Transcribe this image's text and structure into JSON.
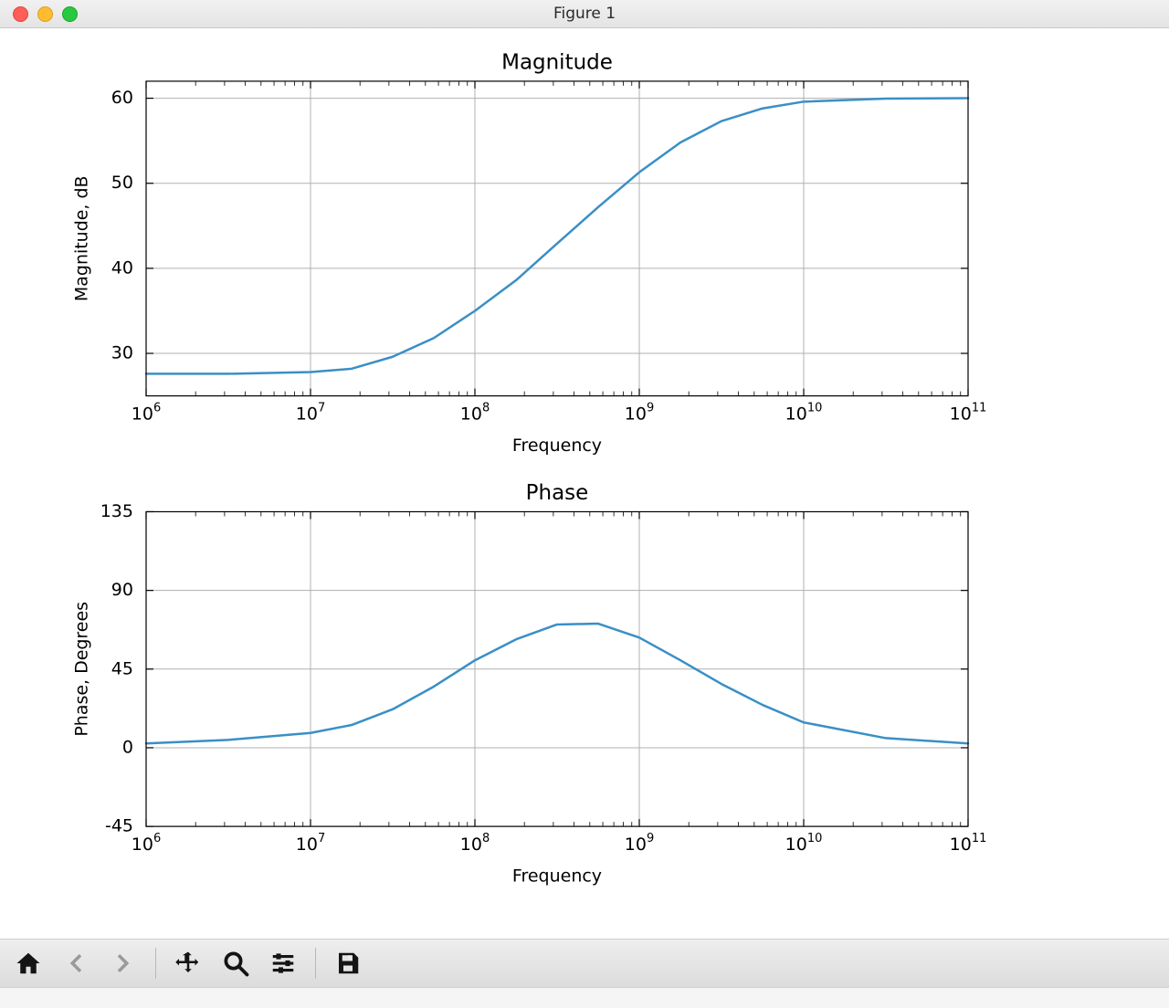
{
  "window": {
    "title": "Figure 1"
  },
  "toolbar": {
    "home": "home-icon",
    "back": "arrow-left-icon",
    "fwd": "arrow-right-icon",
    "pan": "move-icon",
    "zoom": "zoom-icon",
    "config": "sliders-icon",
    "save": "save-icon"
  },
  "chart_data": [
    {
      "type": "line",
      "title": "Magnitude",
      "xlabel": "Frequency",
      "ylabel": "Magnitude, dB",
      "xscale": "log",
      "xlim": [
        1000000.0,
        100000000000.0
      ],
      "ylim": [
        25,
        62
      ],
      "xticks": [
        1000000.0,
        10000000.0,
        100000000.0,
        1000000000.0,
        10000000000.0,
        100000000000.0
      ],
      "xticklabels_exp": [
        6,
        7,
        8,
        9,
        10,
        11
      ],
      "yticks": [
        30,
        40,
        50,
        60
      ],
      "grid": true,
      "series": [
        {
          "name": "magnitude",
          "color": "#3a8fc6",
          "x": [
            1000000.0,
            3160000.0,
            10000000.0,
            17800000.0,
            31600000.0,
            56200000.0,
            100000000.0,
            178000000.0,
            316000000.0,
            562000000.0,
            1000000000.0,
            1780000000.0,
            3160000000.0,
            5620000000.0,
            10000000000.0,
            31600000000.0,
            100000000000.0
          ],
          "y": [
            27.6,
            27.6,
            27.8,
            28.2,
            29.6,
            31.8,
            35.0,
            38.6,
            42.9,
            47.2,
            51.3,
            54.8,
            57.3,
            58.8,
            59.6,
            59.95,
            60.0
          ]
        }
      ]
    },
    {
      "type": "line",
      "title": "Phase",
      "xlabel": "Frequency",
      "ylabel": "Phase, Degrees",
      "xscale": "log",
      "xlim": [
        1000000.0,
        100000000000.0
      ],
      "ylim": [
        -45,
        135
      ],
      "xticks": [
        1000000.0,
        10000000.0,
        100000000.0,
        1000000000.0,
        10000000000.0,
        100000000000.0
      ],
      "xticklabels_exp": [
        6,
        7,
        8,
        9,
        10,
        11
      ],
      "yticks": [
        -45,
        0,
        45,
        90,
        135
      ],
      "grid": true,
      "series": [
        {
          "name": "phase",
          "color": "#3a8fc6",
          "x": [
            1000000.0,
            3160000.0,
            10000000.0,
            17800000.0,
            31600000.0,
            56200000.0,
            100000000.0,
            178000000.0,
            316000000.0,
            562000000.0,
            1000000000.0,
            1780000000.0,
            3160000000.0,
            5620000000.0,
            10000000000.0,
            31600000000.0,
            100000000000.0
          ],
          "y": [
            2.5,
            4.5,
            8.5,
            13.0,
            22.0,
            35.0,
            50.0,
            62.0,
            70.5,
            71.0,
            63.0,
            50.0,
            36.5,
            24.5,
            14.5,
            5.5,
            2.5
          ]
        }
      ]
    }
  ]
}
